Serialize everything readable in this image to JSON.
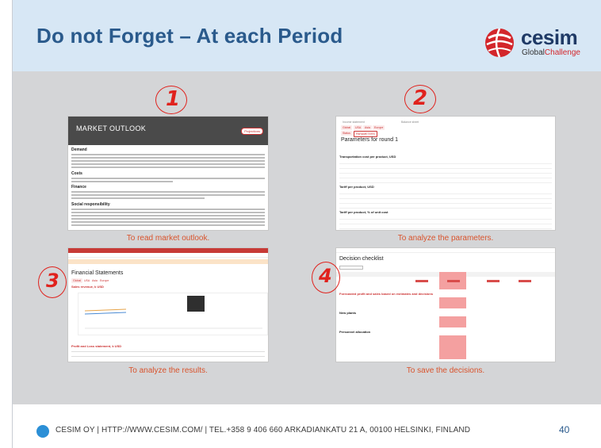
{
  "slide": {
    "title": "Do not Forget – At each Period",
    "page_number": "40"
  },
  "logo": {
    "word": "cesim",
    "sub_plain": "Global",
    "sub_accent": "Challenge"
  },
  "panels": [
    {
      "number": "1",
      "caption": "To read market outlook.",
      "screen_title": "MARKET OUTLOOK",
      "sections": [
        "Demand",
        "Costs",
        "Finance",
        "Social responsibility"
      ]
    },
    {
      "number": "2",
      "caption": "To analyze the parameters.",
      "screen_title": "Parameters for round 1",
      "sections": [
        "Transportation cost per product, USD",
        "Tariff per product, USD",
        "Tariff per product, % of unit cost"
      ]
    },
    {
      "number": "3",
      "caption": "To analyze the results.",
      "screen_title": "Financial Statements",
      "sections": [
        "Sales revenue, k USD",
        "Profit and Loss statement, k USD"
      ]
    },
    {
      "number": "4",
      "caption": "To save the decisions.",
      "screen_title": "Decision checklist",
      "sections": [
        "Forecasted profit and sales based on estimates and decisions",
        "New plants",
        "Personnel allocation"
      ]
    }
  ],
  "footer": {
    "text": "CESIM OY | HTTP://WWW.CESIM.COM/ | TEL.+358 9 406 660   ARKADIANKATU 21 A, 00100 HELSINKI, FINLAND"
  },
  "colors": {
    "header_bg": "#d7e7f5",
    "title": "#2a5a8c",
    "accent_red": "#e0221d",
    "caption": "#d9532c",
    "stage_bg": "#d4d5d7"
  }
}
